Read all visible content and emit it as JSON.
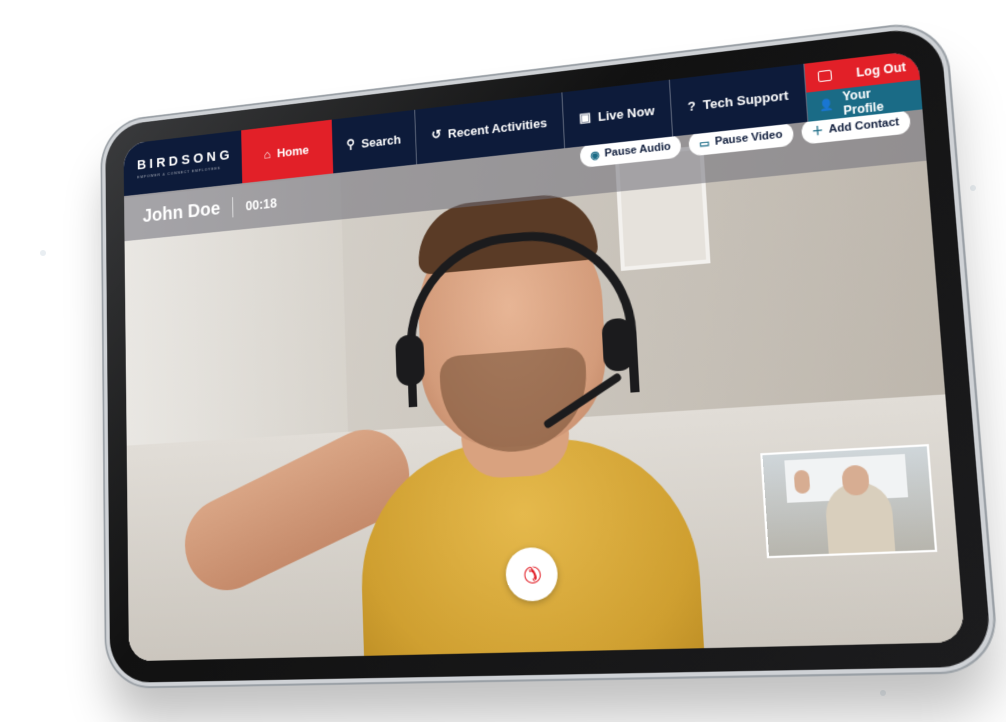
{
  "app": {
    "logo_text": "BIRDSONG",
    "logo_tagline": "EMPOWER & CONNECT EMPLOYEES"
  },
  "nav": {
    "items": [
      {
        "label": "Home",
        "icon": "home-icon",
        "active": true
      },
      {
        "label": "Search",
        "icon": "search-icon",
        "active": false
      },
      {
        "label": "Recent Activities",
        "icon": "history-icon",
        "active": false
      },
      {
        "label": "Live Now",
        "icon": "tv-icon",
        "active": false
      },
      {
        "label": "Tech Support",
        "icon": "help-icon",
        "active": false
      }
    ],
    "logout_label": "Log Out",
    "profile_label": "Your Profile"
  },
  "call": {
    "caller_name": "John Doe",
    "elapsed": "00:18",
    "pause_audio_label": "Pause Audio",
    "pause_video_label": "Pause Video",
    "add_contact_label": "Add Contact"
  },
  "colors": {
    "nav_bg": "#0d1b3a",
    "accent_red": "#e22028",
    "accent_teal": "#1a6b86"
  }
}
